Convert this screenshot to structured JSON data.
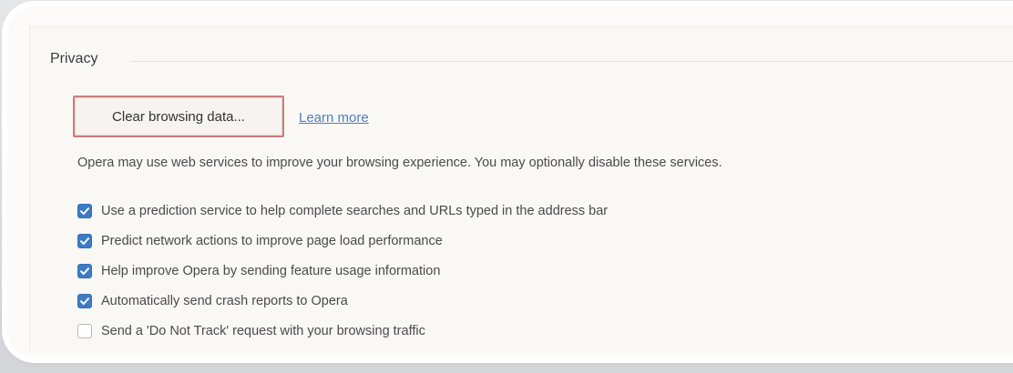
{
  "section": {
    "title": "Privacy"
  },
  "actions": {
    "clear_label": "Clear browsing data...",
    "learn_more_label": "Learn more"
  },
  "info": "Opera may use web services to improve your browsing experience. You may optionally disable these services.",
  "options": [
    {
      "label": "Use a prediction service to help complete searches and URLs typed in the address bar",
      "checked": true
    },
    {
      "label": "Predict network actions to improve page load performance",
      "checked": true
    },
    {
      "label": "Help improve Opera by sending feature usage information",
      "checked": true
    },
    {
      "label": "Automatically send crash reports to Opera",
      "checked": true
    },
    {
      "label": "Send a 'Do Not Track' request with your browsing traffic",
      "checked": false
    }
  ],
  "colors": {
    "checkbox_checked": "#3d7bc4",
    "link": "#4c7fc0",
    "highlight_border": "#c87e7e"
  }
}
